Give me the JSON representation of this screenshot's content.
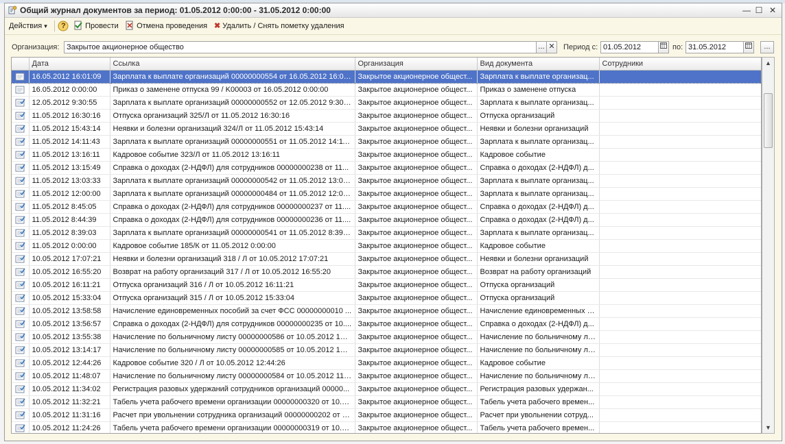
{
  "window": {
    "title": "Общий журнал документов за период: 01.05.2012 0:00:00 - 31.05.2012 0:00:00",
    "close_glyph": "✕",
    "maximize_glyph": "☐",
    "minimize_glyph": "—"
  },
  "toolbar": {
    "actions_label": "Действия",
    "actions_glyph": "▾",
    "help_glyph": "?",
    "post_label": "Провести",
    "unpost_label": "Отмена проведения",
    "delete_label": "Удалить / Снять пометку удаления",
    "delete_glyph": "✖"
  },
  "filter": {
    "org_label": "Организация:",
    "org_value": "Закрытое акционерное общество",
    "org_select_glyph": "...",
    "org_clear_glyph": "✕",
    "period_from_label": "Период с:",
    "period_from": "01.05.2012",
    "period_to_label": "по:",
    "period_to": "31.05.2012",
    "period_btn_glyph": "..."
  },
  "table": {
    "columns": [
      "Дата",
      "Ссылка",
      "Организация",
      "Вид документа",
      "Сотрудники"
    ],
    "rows": [
      {
        "date": "16.05.2012 16:01:09",
        "ref": "Зарплата к выплате организаций 00000000554 от 16.05.2012 16:01...",
        "org": "Закрытое акционерное общест...",
        "type": "Зарплата к выплате организац...",
        "emp": "",
        "posted": false,
        "selected": true
      },
      {
        "date": "16.05.2012 0:00:00",
        "ref": "Приказ о заменене отпуска 99 / K00003 от 16.05.2012 0:00:00",
        "org": "Закрытое акционерное общест...",
        "type": "Приказ о заменене отпуска",
        "emp": "",
        "posted": false
      },
      {
        "date": "12.05.2012 9:30:55",
        "ref": "Зарплата к выплате организаций 00000000552 от 12.05.2012 9:30:55",
        "org": "Закрытое акционерное общест...",
        "type": "Зарплата к выплате организац...",
        "emp": "",
        "posted": true
      },
      {
        "date": "11.05.2012 16:30:16",
        "ref": "Отпуска организаций 325/Л от 11.05.2012 16:30:16",
        "org": "Закрытое акционерное общест...",
        "type": "Отпуска организаций",
        "emp": "",
        "posted": true
      },
      {
        "date": "11.05.2012 15:43:14",
        "ref": "Неявки и болезни организаций 324/Л от 11.05.2012 15:43:14",
        "org": "Закрытое акционерное общест...",
        "type": "Неявки и болезни организаций",
        "emp": "",
        "posted": true
      },
      {
        "date": "11.05.2012 14:11:43",
        "ref": "Зарплата к выплате организаций 00000000551 от 11.05.2012 14:11...",
        "org": "Закрытое акционерное общест...",
        "type": "Зарплата к выплате организац...",
        "emp": "",
        "posted": true
      },
      {
        "date": "11.05.2012 13:16:11",
        "ref": "Кадровое событие 323/Л от 11.05.2012 13:16:11",
        "org": "Закрытое акционерное общест...",
        "type": "Кадровое событие",
        "emp": "",
        "posted": true
      },
      {
        "date": "11.05.2012 13:15:49",
        "ref": "Справка о доходах (2-НДФЛ) для сотрудников 00000000238 от 11...",
        "org": "Закрытое акционерное общест...",
        "type": "Справка о доходах (2-НДФЛ) д...",
        "emp": "",
        "posted": true
      },
      {
        "date": "11.05.2012 13:03:33",
        "ref": "Зарплата к выплате организаций 00000000542 от 11.05.2012 13:03...",
        "org": "Закрытое акционерное общест...",
        "type": "Зарплата к выплате организац...",
        "emp": "",
        "posted": true
      },
      {
        "date": "11.05.2012 12:00:00",
        "ref": "Зарплата к выплате организаций 00000000484 от 11.05.2012 12:00...",
        "org": "Закрытое акционерное общест...",
        "type": "Зарплата к выплате организац...",
        "emp": "",
        "posted": true
      },
      {
        "date": "11.05.2012 8:45:05",
        "ref": "Справка о доходах (2-НДФЛ) для сотрудников 00000000237 от 11....",
        "org": "Закрытое акционерное общест...",
        "type": "Справка о доходах (2-НДФЛ) д...",
        "emp": "",
        "posted": true
      },
      {
        "date": "11.05.2012 8:44:39",
        "ref": "Справка о доходах (2-НДФЛ) для сотрудников 00000000236 от 11....",
        "org": "Закрытое акционерное общест...",
        "type": "Справка о доходах (2-НДФЛ) д...",
        "emp": "",
        "posted": true
      },
      {
        "date": "11.05.2012 8:39:03",
        "ref": "Зарплата к выплате организаций 00000000541 от 11.05.2012 8:39:03",
        "org": "Закрытое акционерное общест...",
        "type": "Зарплата к выплате организац...",
        "emp": "",
        "posted": true
      },
      {
        "date": "11.05.2012 0:00:00",
        "ref": "Кадровое событие 185/К от 11.05.2012 0:00:00",
        "org": "Закрытое акционерное общест...",
        "type": "Кадровое событие",
        "emp": "",
        "posted": true
      },
      {
        "date": "10.05.2012 17:07:21",
        "ref": "Неявки и болезни организаций 318 / Л от 10.05.2012 17:07:21",
        "org": "Закрытое акционерное общест...",
        "type": "Неявки и болезни организаций",
        "emp": "",
        "posted": true
      },
      {
        "date": "10.05.2012 16:55:20",
        "ref": "Возврат на работу организаций 317 / Л от 10.05.2012 16:55:20",
        "org": "Закрытое акционерное общест...",
        "type": "Возврат на работу организаций",
        "emp": "",
        "posted": true
      },
      {
        "date": "10.05.2012 16:11:21",
        "ref": "Отпуска организаций 316 / Л от 10.05.2012 16:11:21",
        "org": "Закрытое акционерное общест...",
        "type": "Отпуска организаций",
        "emp": "",
        "posted": true
      },
      {
        "date": "10.05.2012 15:33:04",
        "ref": "Отпуска организаций 315 / Л от 10.05.2012 15:33:04",
        "org": "Закрытое акционерное общест...",
        "type": "Отпуска организаций",
        "emp": "",
        "posted": true
      },
      {
        "date": "10.05.2012 13:58:58",
        "ref": "Начисление единовременных пособий за счет ФСС 00000000010 ...",
        "org": "Закрытое акционерное общест...",
        "type": "Начисление единовременных п...",
        "emp": "",
        "posted": true
      },
      {
        "date": "10.05.2012 13:56:57",
        "ref": "Справка о доходах (2-НДФЛ) для сотрудников 00000000235 от 10....",
        "org": "Закрытое акционерное общест...",
        "type": "Справка о доходах (2-НДФЛ) д...",
        "emp": "",
        "posted": true
      },
      {
        "date": "10.05.2012 13:55:38",
        "ref": "Начисление по больничному листу 00000000586 от 10.05.2012 13:5...",
        "org": "Закрытое акционерное общест...",
        "type": "Начисление по больничному ли...",
        "emp": "",
        "posted": true
      },
      {
        "date": "10.05.2012 13:14:17",
        "ref": "Начисление по больничному листу 00000000585 от 10.05.2012 13:1...",
        "org": "Закрытое акционерное общест...",
        "type": "Начисление по больничному ли...",
        "emp": "",
        "posted": true
      },
      {
        "date": "10.05.2012 12:44:26",
        "ref": "Кадровое событие 320 / Л от 10.05.2012 12:44:26",
        "org": "Закрытое акционерное общест...",
        "type": "Кадровое событие",
        "emp": "",
        "posted": true
      },
      {
        "date": "10.05.2012 11:48:07",
        "ref": "Начисление по больничному листу 00000000584 от 10.05.2012 11:4...",
        "org": "Закрытое акционерное общест...",
        "type": "Начисление по больничному ли...",
        "emp": "",
        "posted": true
      },
      {
        "date": "10.05.2012 11:34:02",
        "ref": "Регистрация разовых удержаний сотрудников организаций 00000...",
        "org": "Закрытое акционерное общест...",
        "type": "Регистрация разовых удержан...",
        "emp": "",
        "posted": true
      },
      {
        "date": "10.05.2012 11:32:21",
        "ref": "Табель учета рабочего времени организации 00000000320 от 10.0...",
        "org": "Закрытое акционерное общест...",
        "type": "Табель учета рабочего времен...",
        "emp": "",
        "posted": true
      },
      {
        "date": "10.05.2012 11:31:16",
        "ref": "Расчет при увольнении сотрудника организаций 00000000202 от 1...",
        "org": "Закрытое акционерное общест...",
        "type": "Расчет при увольнении сотруд...",
        "emp": "",
        "posted": true
      },
      {
        "date": "10.05.2012 11:24:26",
        "ref": "Табель учета рабочего времени организации 00000000319 от 10.0...",
        "org": "Закрытое акционерное общест...",
        "type": "Табель учета рабочего времен...",
        "emp": "",
        "posted": true
      }
    ]
  },
  "scrollbar": {
    "up_glyph": "▲",
    "down_glyph": "▼"
  }
}
